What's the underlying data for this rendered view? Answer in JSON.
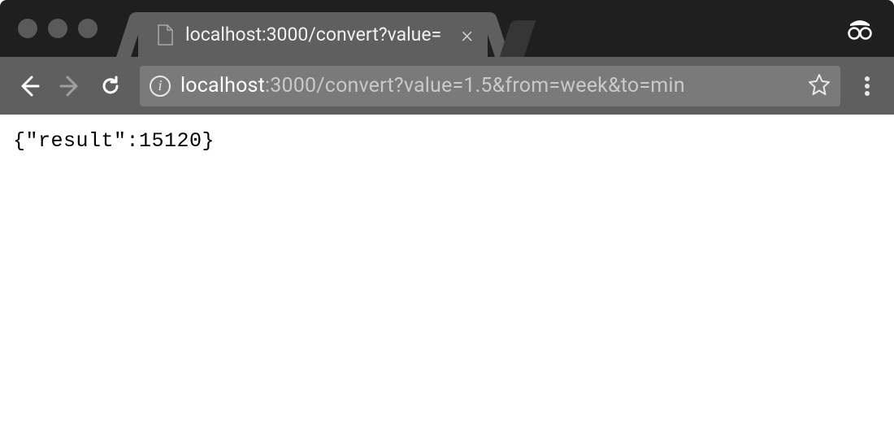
{
  "tab": {
    "title": "localhost:3000/convert?value="
  },
  "url": {
    "host": "localhost",
    "rest": ":3000/convert?value=1.5&from=week&to=min"
  },
  "page": {
    "body": "{\"result\":15120}"
  }
}
